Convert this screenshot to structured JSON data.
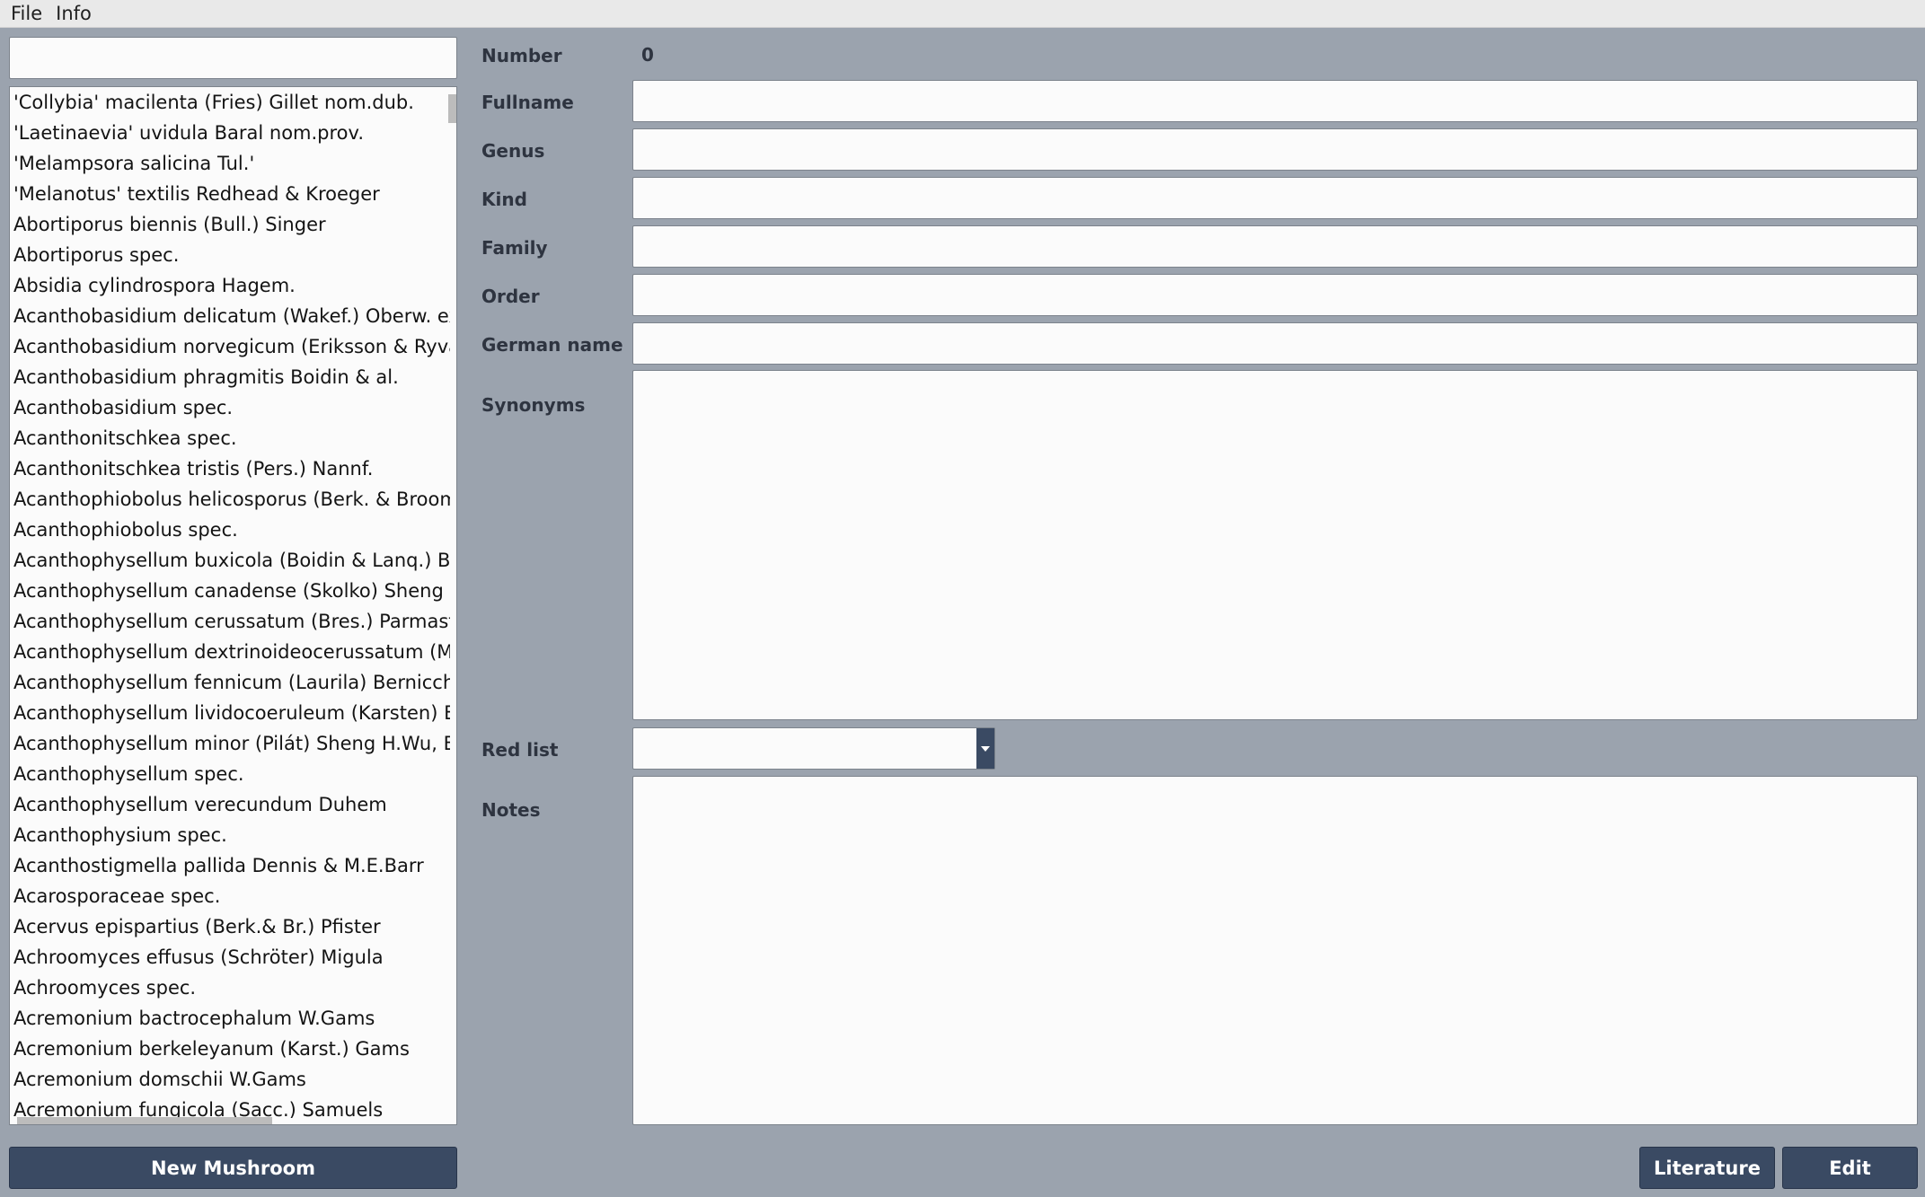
{
  "menu": [
    "File",
    "Info"
  ],
  "search": {
    "value": ""
  },
  "species": [
    "'Collybia' macilenta (Fries) Gillet nom.dub.",
    "'Laetinaevia' uvidula Baral nom.prov.",
    "'Melampsora salicina Tul.'",
    "'Melanotus' textilis Redhead & Kroeger",
    "Abortiporus biennis (Bull.) Singer",
    "Abortiporus spec.",
    "Absidia cylindrospora Hagem.",
    "Acanthobasidium delicatum (Wakef.) Oberw. ex",
    "Acanthobasidium norvegicum (Eriksson & Ryva",
    "Acanthobasidium phragmitis Boidin & al.",
    "Acanthobasidium spec.",
    "Acanthonitschkea spec.",
    "Acanthonitschkea tristis (Pers.) Nannf.",
    "Acanthophiobolus helicosporus (Berk. & Broom",
    "Acanthophiobolus spec.",
    "Acanthophysellum buxicola (Boidin & Lanq.) Bc",
    "Acanthophysellum canadense (Skolko) Sheng H",
    "Acanthophysellum cerussatum (Bres.) Parmast",
    "Acanthophysellum dextrinoideocerussatum (Ma",
    "Acanthophysellum fennicum (Laurila) Bernicchi",
    "Acanthophysellum lividocoeruleum (Karsten) Be",
    "Acanthophysellum minor (Pilát) Sheng H.Wu, Bc",
    "Acanthophysellum spec.",
    "Acanthophysellum verecundum Duhem",
    "Acanthophysium spec.",
    "Acanthostigmella pallida Dennis & M.E.Barr",
    "Acarosporaceae spec.",
    "Acervus epispartius (Berk.& Br.) Pfister",
    "Achroomyces effusus (Schröter) Migula",
    "Achroomyces spec.",
    "Acremonium bactrocephalum W.Gams",
    "Acremonium berkeleyanum (Karst.) Gams",
    "Acremonium domschii W.Gams",
    "Acremonium fungicola (Sacc.) Samuels"
  ],
  "buttons": {
    "new_mushroom": "New Mushroom",
    "literature": "Literature",
    "edit": "Edit"
  },
  "form": {
    "number_label": "Number",
    "number_value": "0",
    "fullname_label": "Fullname",
    "fullname_value": "",
    "genus_label": "Genus",
    "genus_value": "",
    "kind_label": "Kind",
    "kind_value": "",
    "family_label": "Family",
    "family_value": "",
    "order_label": "Order",
    "order_value": "",
    "german_label": "German name",
    "german_value": "",
    "synonyms_label": "Synonyms",
    "synonyms_value": "",
    "redlist_label": "Red list",
    "redlist_value": "",
    "notes_label": "Notes",
    "notes_value": ""
  }
}
